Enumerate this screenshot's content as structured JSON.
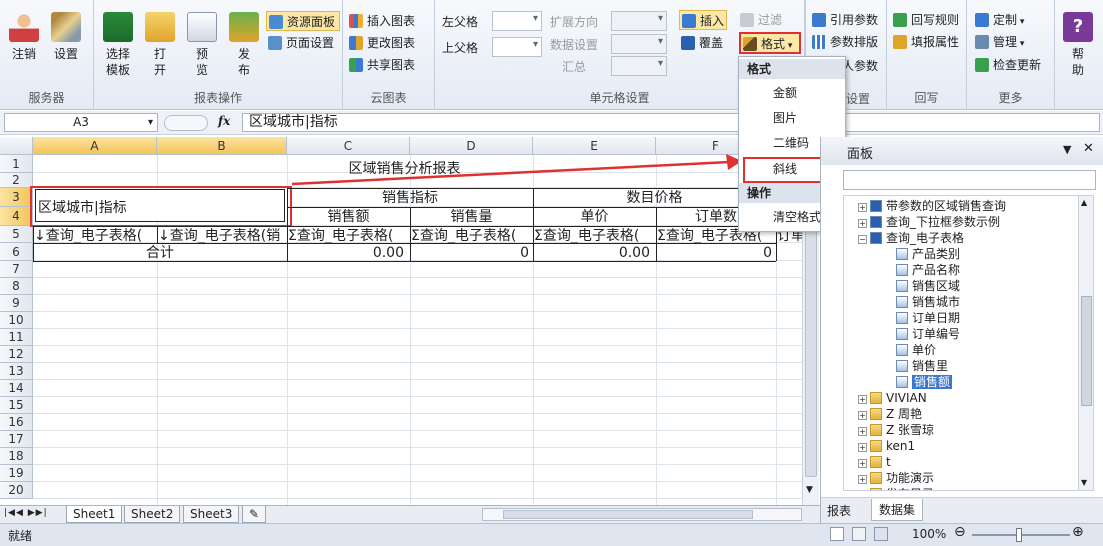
{
  "ribbon": {
    "groups": {
      "server": {
        "label": "服务器",
        "logout": "注销",
        "settings": "设置"
      },
      "report_ops": {
        "label": "报表操作",
        "select_template": "选择模板",
        "open": "打开",
        "preview": "预览",
        "publish": "发布"
      },
      "cloud": {
        "label": "云图表"
      },
      "cell_settings": {
        "label": "单元格设置",
        "left_parent": "左父格",
        "top_parent": "上父格",
        "expand_dir": "扩展方向",
        "data_settings": "数据设置",
        "summary": "汇总"
      },
      "more": {
        "label": "更多"
      },
      "writeback": {
        "label": "回写"
      }
    },
    "resource_panel": "资源面板",
    "page_settings": "页面设置",
    "insert_chart": "插入图表",
    "change_chart": "更改图表",
    "share_chart": "共享图表",
    "insert": "插入",
    "overwrite": "覆盖",
    "filter": "过滤",
    "format": "格式",
    "ref_params": "引用参数",
    "param_layout": "参数排版",
    "params_tail": "人参数",
    "settings_tail": "设置",
    "writeback_rule": "回写规则",
    "fill_attr": "填报属性",
    "custom": "定制",
    "manage": "管理",
    "check_update": "检查更新",
    "help": "帮助"
  },
  "formula_bar": {
    "cell_ref": "A3",
    "fx": "fx",
    "content": "区域城市|指标"
  },
  "sheet": {
    "columns": [
      "A",
      "B",
      "C",
      "D",
      "E",
      "F"
    ],
    "rows": [
      "1",
      "2",
      "3",
      "4",
      "5",
      "6",
      "7",
      "8",
      "9",
      "10",
      "11",
      "12",
      "13",
      "14",
      "15",
      "16",
      "17",
      "18",
      "19",
      "20"
    ],
    "title": "区域销售分析报表",
    "corner_cell": "区域城市|指标",
    "hdr_sales": "销售指标",
    "hdr_price": "数目价格",
    "sub_amount": "销售额",
    "sub_qty": "销售量",
    "sub_unit": "单价",
    "sub_order": "订单数",
    "r5": [
      "↓查询_电子表格(",
      "↓查询_电子表格(销",
      "Σ查询_电子表格(",
      "Σ查询_电子表格(",
      "Σ查询_电子表格(",
      "Σ查询_电子表格(",
      "订单"
    ],
    "total_label": "合计",
    "totals": [
      "0.00",
      "0",
      "0.00",
      "0"
    ]
  },
  "sheet_tabs": [
    "Sheet1",
    "Sheet2",
    "Sheet3"
  ],
  "format_menu": {
    "header_format": "格式",
    "items": [
      "金额",
      "图片",
      "二维码",
      "斜线"
    ],
    "header_ops": "操作",
    "clear": "清空格式"
  },
  "panel": {
    "title": "面板",
    "tree": [
      {
        "label": "带参数的区域销售查询",
        "level": 0
      },
      {
        "label": "查询_下拉框参数示例",
        "level": 0
      },
      {
        "label": "查询_电子表格",
        "level": 0
      },
      {
        "label": "产品类别",
        "level": 1
      },
      {
        "label": "产品名称",
        "level": 1
      },
      {
        "label": "销售区域",
        "level": 1
      },
      {
        "label": "销售城市",
        "level": 1
      },
      {
        "label": "订单日期",
        "level": 1
      },
      {
        "label": "订单编号",
        "level": 1
      },
      {
        "label": "单价",
        "level": 1
      },
      {
        "label": "销售里",
        "level": 1
      },
      {
        "label": "销售额",
        "level": 1
      }
    ],
    "folders": [
      "VIVIAN",
      "Z 周艳",
      "Z 张雪琼",
      "ken1",
      "t",
      "功能演示",
      "发布目录"
    ],
    "tabs": [
      "报表",
      "数据集"
    ]
  },
  "status": {
    "text": "就绪",
    "zoom": "100%"
  },
  "colors": {
    "highlight": "#e03030",
    "selected": "#3a78d0"
  }
}
